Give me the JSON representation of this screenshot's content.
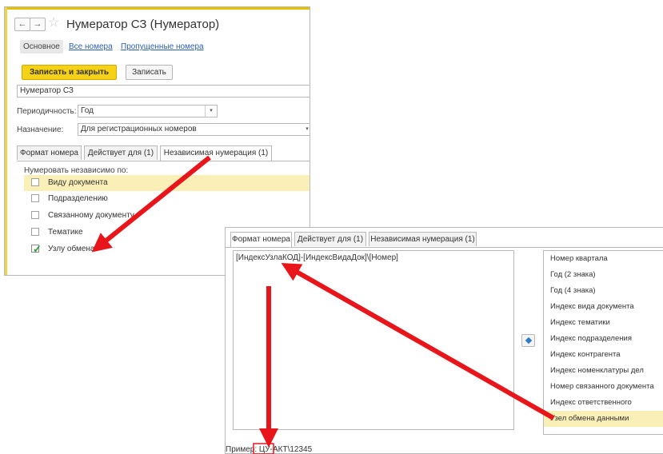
{
  "window1": {
    "title": "Нумератор СЗ (Нумератор)",
    "nav": {
      "back": "←",
      "forward": "→",
      "favorite": "☆"
    },
    "tabs": [
      "Основное",
      "Все номера",
      "Пропущенные номера"
    ],
    "save_close_label": "Записать и закрыть",
    "save_label": "Записать",
    "name_value": "Нумератор СЗ",
    "periodicity_label": "Периодичность:",
    "periodicity_value": "Год",
    "purpose_label": "Назначение:",
    "purpose_value": "Для регистрационных номеров",
    "inner_tabs": [
      "Формат номера",
      "Действует для (1)",
      "Независимая нумерация (1)"
    ],
    "independent_label": "Нумеровать независимо по:",
    "options": [
      {
        "label": "Виду документа",
        "checked": false,
        "selected": true
      },
      {
        "label": "Подразделению",
        "checked": false,
        "selected": false
      },
      {
        "label": "Связанному документу",
        "checked": false,
        "selected": false
      },
      {
        "label": "Тематике",
        "checked": false,
        "selected": false
      },
      {
        "label": "Узлу обмена",
        "checked": true,
        "selected": false
      }
    ]
  },
  "window2": {
    "tabs": [
      "Формат номера",
      "Действует для (1)",
      "Независимая нумерация (1)"
    ],
    "format_value": "[ИндексУзлаКОД]-[ИндексВидаДок]\\[Номер]",
    "fields": [
      "Номер квартала",
      "Год (2 знака)",
      "Год (4 знака)",
      "Индекс вида документа",
      "Индекс тематики",
      "Индекс подразделения",
      "Индекс контрагента",
      "Индекс номенклатуры дел",
      "Номер связанного документа",
      "Индекс ответственного",
      "Узел обмена данными"
    ],
    "selected_field_index": 10,
    "example_label": "Пример:",
    "example_value": "ЦУ-АКТ\\12345"
  },
  "colors": {
    "accent_yellow": "#f5d215",
    "selection": "#fbefb8",
    "annotation_red": "#e8151b",
    "link": "#2a5fb3"
  }
}
